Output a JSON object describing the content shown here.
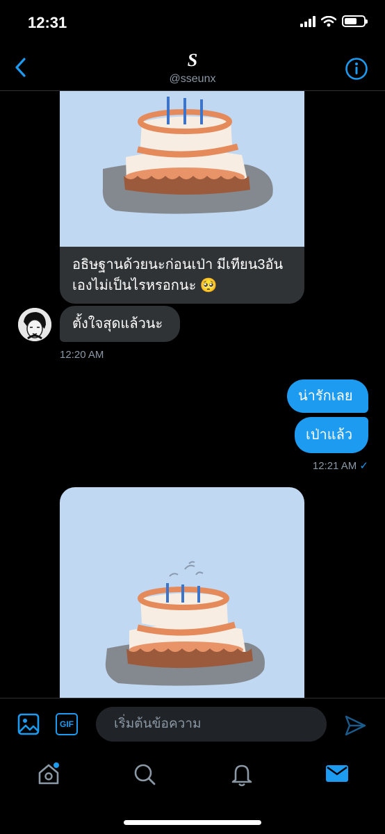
{
  "status_bar": {
    "time": "12:31"
  },
  "header": {
    "name": "S",
    "handle": "@sseunx"
  },
  "messages": {
    "received_caption": "อธิษฐานด้วยนะก่อนเป่า มีเทียน3อันเองไม่เป็นไรหรอกนะ",
    "received_emoji": "🥺",
    "received_text": "ตั้งใจสุดแล้วนะ",
    "received_time": "12:20 AM",
    "sent_1": "น่ารักเลย",
    "sent_2": "เป่าแล้ว",
    "sent_time": "12:21 AM",
    "sent_check": "✓"
  },
  "composer": {
    "placeholder": "เริ่มต้นข้อความ",
    "gif_label": "GIF"
  },
  "colors": {
    "accent": "#1d9bf0",
    "cake_bg": "#c0d8f2",
    "bubble_dark": "#2f3336"
  },
  "icons": [
    "back-arrow-icon",
    "info-icon",
    "image-icon",
    "gif-icon",
    "send-icon",
    "home-icon",
    "search-icon",
    "notifications-icon",
    "messages-icon"
  ]
}
